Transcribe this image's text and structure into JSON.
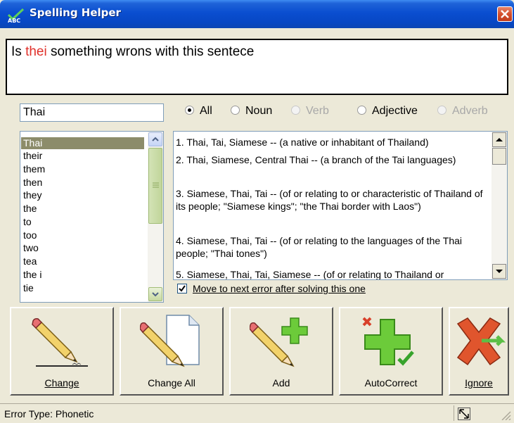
{
  "window": {
    "title": "Spelling Helper",
    "app_icon": "abc-checkmark-icon"
  },
  "sentence": {
    "before": "Is ",
    "error_word": "thei",
    "after": " something wrons with this sentece",
    "error_color": "#e0302a"
  },
  "word_field": {
    "value": "Thai"
  },
  "filters": [
    {
      "label": "All",
      "selected": true,
      "enabled": true
    },
    {
      "label": "Noun",
      "selected": false,
      "enabled": true
    },
    {
      "label": "Verb",
      "selected": false,
      "enabled": false
    },
    {
      "label": "Adjective",
      "selected": false,
      "enabled": true
    },
    {
      "label": "Adverb",
      "selected": false,
      "enabled": false
    }
  ],
  "suggestions": [
    "Thai",
    "their",
    "them",
    "then",
    "they",
    "the",
    "to",
    "too",
    "two",
    "tea",
    "the i",
    "tie"
  ],
  "selected_suggestion": "Thai",
  "definitions": [
    "1. Thai, Tai, Siamese -- (a native or inhabitant of Thailand)",
    "2. Thai, Siamese, Central Thai -- (a branch of the Tai languages)",
    "3. Siamese, Thai, Tai -- (of or relating to or characteristic of Thailand of its people; \"Siamese kings\"; \"the Thai border with Laos\")",
    "4. Siamese, Thai, Tai -- (of or relating to the languages of the Thai people; \"Thai tones\")",
    "5. Siamese, Thai, Tai, Siamese -- (of or relating to Thailand or"
  ],
  "move_next": {
    "label": "Move to next error after solving this one",
    "checked": true
  },
  "buttons": {
    "change": {
      "label": "Change",
      "icon": "pencil-icon"
    },
    "change_all": {
      "label": "Change All",
      "icon": "pencil-document-icon"
    },
    "add": {
      "label": "Add",
      "icon": "pencil-plus-icon"
    },
    "autocorrect": {
      "label": "AutoCorrect",
      "icon": "autocorrect-plus-icon"
    },
    "ignore": {
      "label": "Ignore",
      "icon": "red-x-icon"
    }
  },
  "status": {
    "text": "Error Type:  Phonetic"
  },
  "colors": {
    "titlebar": "#0a4ed0",
    "selection": "#8c8c6a",
    "window_bg": "#ece9d8"
  }
}
